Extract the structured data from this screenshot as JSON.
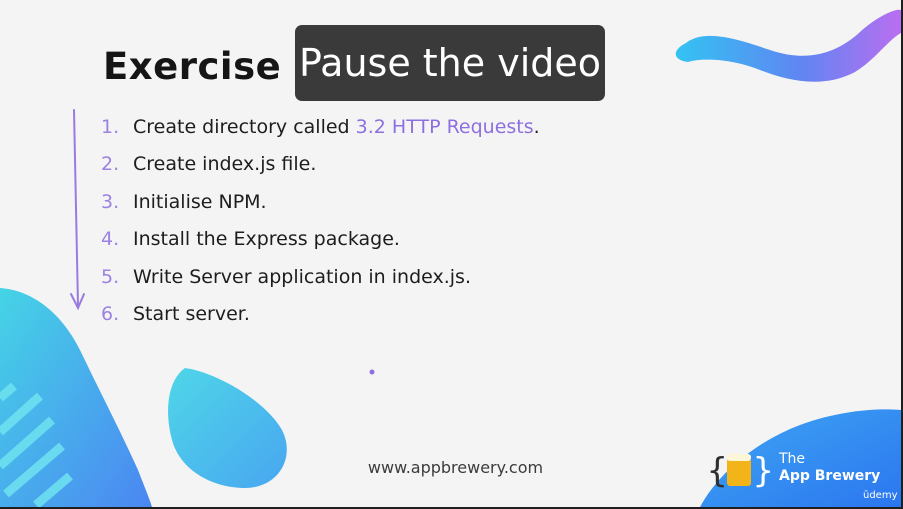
{
  "slide": {
    "title": "Exercise",
    "overlay": "Pause the video",
    "steps": [
      {
        "num": "1.",
        "text": "Create directory called ",
        "highlight": "3.2 HTTP Requests",
        "suffix": "."
      },
      {
        "num": "2.",
        "text": "Create index.js file."
      },
      {
        "num": "3.",
        "text": "Initialise NPM."
      },
      {
        "num": "4.",
        "text": "Install the Express package."
      },
      {
        "num": "5.",
        "text": "Write Server application in index.js."
      },
      {
        "num": "6.",
        "text": "Start server."
      }
    ],
    "website": "www.appbrewery.com"
  },
  "brand": {
    "line1": "The",
    "line2": "App Brewery",
    "logo_icon": "curly-braces-beer-mug-icon"
  },
  "watermark": "ūdemy",
  "colors": {
    "accent_purple": "#8e6fe0",
    "overlay_bg": "#3a3a3a",
    "wave_cyan": "#4fd2e6",
    "wave_blue": "#4d8cf5"
  }
}
